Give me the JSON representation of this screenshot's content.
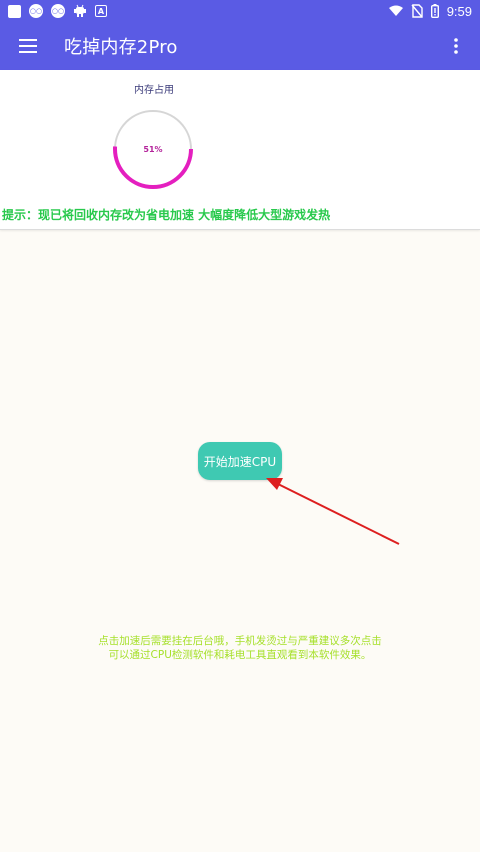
{
  "status_bar": {
    "time": "9:59",
    "left_icons": [
      "app-square-icon",
      "gamepad-icon",
      "gamepad-icon",
      "robot-icon",
      "font-a-icon"
    ],
    "right_icons": [
      "wifi-icon",
      "no-sim-icon",
      "battery-icon"
    ]
  },
  "app_bar": {
    "title": "吃掉内存2Pro",
    "icons": [
      "menu-icon",
      "more-vert-icon"
    ]
  },
  "memory_card": {
    "label": "内存占用",
    "percent_text": "51%",
    "percent_value": 0.51,
    "tip": "提示：现已将回收内存改为省电加速 大幅度降低大型游戏发热"
  },
  "start_button": {
    "label": "开始加速CPU"
  },
  "hint": {
    "line1": "点击加速后需要挂在后台哦，手机发烫过与严重建议多次点击",
    "line2": "可以通过CPU检测软件和耗电工具直观看到本软件效果。"
  },
  "colors": {
    "primary": "#5a5be4",
    "gauge_track": "#d6d6d6",
    "gauge_fill": "#e41fbf",
    "tip_text": "#28c94c",
    "button": "#3fc9b2",
    "arrow": "#dd1f1f",
    "hint_text": "#a6e02a",
    "background": "#fdfbf6"
  }
}
